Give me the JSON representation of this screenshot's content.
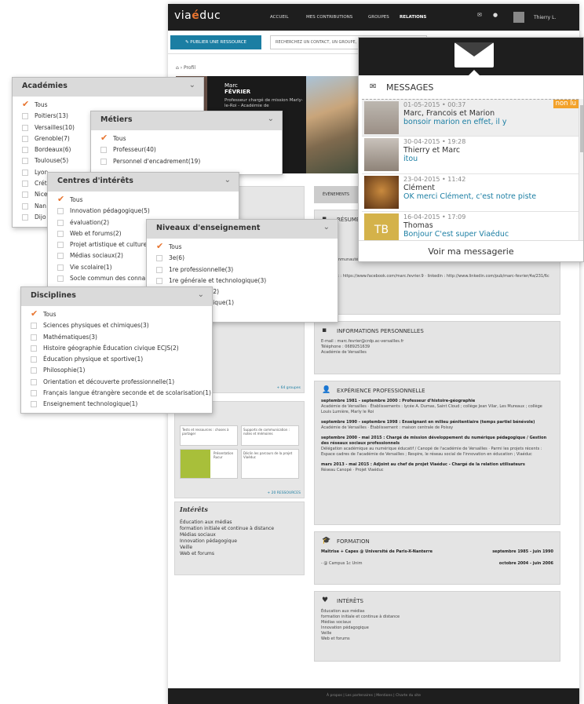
{
  "nav": {
    "logo_pre": "via",
    "logo_mid": "é",
    "logo_post": "duc",
    "links": [
      "ACCUEIL",
      "MES CONTRIBUTIONS",
      "GROUPES",
      "RELATIONS"
    ],
    "user": "Thierry L."
  },
  "toolbar": {
    "publish": "✎  PUBLIER UNE RESSOURCE",
    "search_placeholder": "RECHERCHEZ UN CONTACT, UN GROUPE, UNE R..."
  },
  "breadcrumb": "⌂ › Profil",
  "profile": {
    "first": "Marc",
    "last": "FÉVRIER",
    "subtitle": "Professeur chargé de mission Marly-le-Roi - Académie de"
  },
  "sections": {
    "resume_title": "RÉSUMÉ",
    "resume_body": "... de communautés, réseaux sociaux professionnels.",
    "resume_links": "facebook : https://www.facebook.com/marc.fevrier.9 · linkedin : http://www.linkedin.com/pub/marc-fevrier/4a/231/6c",
    "info_title": "INFORMATIONS PERSONNELLES",
    "info_email": "E-mail : marc.fevrier@crdp.ac-versailles.fr",
    "info_phone": "Téléphone : 0689251639",
    "info_acad": "Académie de Versailles",
    "exp_title": "EXPÉRIENCE PROFESSIONNELLE",
    "exp": [
      {
        "h": "septembre 1981 - septembre 2000 : Professeur d'histoire-géographie",
        "b": "Académie de Versailles · Établissements : lycée A. Dumas, Saint Cloud ; collège Jean Vilar, Les Mureaux ; collège Louis Lumière, Marly le Roi"
      },
      {
        "h": "septembre 1990 - septembre 1998 : Enseignant en milieu pénitentiaire (temps partiel bénévole)",
        "b": "Académie de Versailles · Établissement : maison centrale de Poissy"
      },
      {
        "h": "septembre 2000 - mai 2015 : Chargé de mission développement du numérique pédagogique / Gestion des réseaux sociaux professionnels",
        "b": "Délégation académique au numérique éducatif / Canopé de l'académie de Versailles · Parmi les projets récents : Espace cadres de l'académie de Versailles ; Respire, le réseau social de l'innovation en éducation ; Viaéduc"
      },
      {
        "h": "mars 2013 - mai 2015 : Adjoint au chef de projet Viaéduc - Chargé de la relation utilisateurs",
        "b": "Réseau Canopé · Projet Viaéduc"
      }
    ],
    "form_title": "FORMATION",
    "form": [
      {
        "l": "Maîtrise + Capes @ Université de Paris-X-Nanterre",
        "r": "septembre 1985 - juin 1990"
      },
      {
        "l": "- @ Campus 1c Unim",
        "r": "octobre 2004 - juin 2006"
      }
    ],
    "int_title": "INTÉRÊTS",
    "int_items": [
      "Éducation aux médias",
      "formation initiale et continue à distance",
      "Médias sociaux",
      "Innovation pédagogique",
      "Veille",
      "Web et forums"
    ]
  },
  "left": {
    "tab": "ÉVÉNEMENTS",
    "more1": "+ 64 groupes",
    "res_title": "36 ressources",
    "cards": [
      "Tests et ressources : choses à partager",
      "Supports de communication : notes et mémoires",
      "Présentation Rucur",
      "Déclin les parcours de la projet Viaéduc"
    ],
    "more2": "+ 20 RESSOURCES",
    "interests_title": "Intérêts",
    "interests": [
      "Éducation aux médias",
      "formation initiale et continue à distance",
      "Médias sociaux",
      "Innovation pédagogique",
      "Veille",
      "Web et forums"
    ]
  },
  "footer": "À propos  |  Les partenaires  |  Mentions  |  Charte du site",
  "filters": {
    "academies": {
      "title": "Académies",
      "items": [
        {
          "l": "Tous",
          "c": true
        },
        {
          "l": "Poitiers(13)"
        },
        {
          "l": "Versailles(10)"
        },
        {
          "l": "Grenoble(7)"
        },
        {
          "l": "Bordeaux(6)"
        },
        {
          "l": "Toulouse(5)"
        },
        {
          "l": "Lyon"
        },
        {
          "l": "Crét"
        },
        {
          "l": "Nice"
        },
        {
          "l": "Nan"
        },
        {
          "l": "Dijo"
        }
      ]
    },
    "metiers": {
      "title": "Métiers",
      "items": [
        {
          "l": "Tous",
          "c": true
        },
        {
          "l": "Professeur(40)"
        },
        {
          "l": "Personnel d'encadrement(19)"
        }
      ]
    },
    "centres": {
      "title": "Centres d'intérêts",
      "items": [
        {
          "l": "Tous",
          "c": true
        },
        {
          "l": "Innovation pédagogique(5)"
        },
        {
          "l": "évaluation(2)"
        },
        {
          "l": "Web et forums(2)"
        },
        {
          "l": "Projet artistique et culturel"
        },
        {
          "l": "Médias sociaux(2)"
        },
        {
          "l": "Vie scolaire(1)"
        },
        {
          "l": "Socle commun des connaiss"
        }
      ]
    },
    "niveaux": {
      "title": "Niveaux d'enseignement",
      "items": [
        {
          "l": "Tous",
          "c": true
        },
        {
          "l": "3e(6)"
        },
        {
          "l": "1re professionnelle(3)"
        },
        {
          "l": "1re générale et technologique(3)"
        },
        {
          "l": "technologique(2)"
        },
        {
          "l": "le et technologique(1)"
        },
        {
          "l": "essionnelle(1)"
        }
      ]
    },
    "disciplines": {
      "title": "Disciplines",
      "items": [
        {
          "l": "Tous",
          "c": true
        },
        {
          "l": "Sciences physiques et chimiques(3)"
        },
        {
          "l": "Mathématiques(3)"
        },
        {
          "l": "Histoire géographie Éducation civique ECJS(2)"
        },
        {
          "l": "Éducation physique et sportive(1)"
        },
        {
          "l": "Philosophie(1)"
        },
        {
          "l": "Orientation et découverte professionnelle(1)"
        },
        {
          "l": "Français langue étrangère seconde et de scolarisation(1)"
        },
        {
          "l": "Enseignement technologique(1)"
        }
      ]
    }
  },
  "messages": {
    "title": "MESSAGES",
    "unread": "non lu",
    "items": [
      {
        "date": "01-05-2015 • 00:37",
        "from": "Marc, Francois et Marion",
        "text": "bonsoir marion en effet, il y"
      },
      {
        "date": "30-04-2015 • 19:28",
        "from": "Thierry et Marc",
        "text": "itou"
      },
      {
        "date": "23-04-2015 • 11:42",
        "from": "Clément",
        "text": "OK merci Clément, c'est notre piste"
      },
      {
        "date": "16-04-2015 • 17:09",
        "from": "Thomas",
        "text": "Bonjour C'est super Viaéduc"
      }
    ],
    "tb": "TB",
    "footer": "Voir ma messagerie"
  }
}
